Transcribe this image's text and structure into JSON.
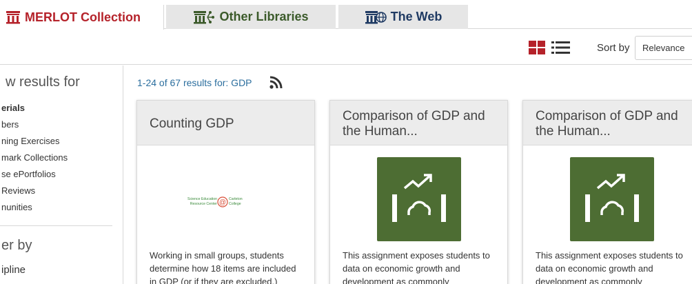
{
  "tabs": {
    "merlot": "MERLOT Collection",
    "other": "Other Libraries",
    "web": "The Web"
  },
  "toolbar": {
    "sort_label": "Sort by",
    "sort_value": "Relevance"
  },
  "sidebar": {
    "heading": "w results for",
    "items": [
      "erials",
      "bers",
      "ning Exercises",
      "mark Collections",
      "se ePortfolios",
      "Reviews",
      "nunities"
    ],
    "filter_heading": "er by",
    "filter_first": "ipline"
  },
  "results": {
    "count_text": "1-24 of 67 results for: GDP"
  },
  "cards": [
    {
      "title": "Counting GDP",
      "logo_text_left_1": "Science Education",
      "logo_text_left_2": "Resource Center",
      "logo_text_right_1": "Carleton",
      "logo_text_right_2": "College",
      "desc": "Working in small groups, students determine how 18 items are included in GDP (or if they are excluded.)"
    },
    {
      "title": "Comparison of GDP and the Human...",
      "desc": "This assignment exposes students to data on economic growth and development as commonly"
    },
    {
      "title": "Comparison of GDP and the Human...",
      "desc": "This assignment exposes students to data on economic growth and development as commonly"
    }
  ],
  "colors": {
    "merlot_red": "#b5222a",
    "other_green": "#3b5a2a",
    "web_navy": "#1f3a63",
    "exercise_icon_green": "#4d6d33",
    "link_blue": "#2b6e9e"
  },
  "icons": {
    "merlot": "library-building-icon",
    "other": "library-network-icon",
    "web": "library-globe-icon",
    "grid": "grid-view-icon",
    "list": "list-view-icon",
    "rss": "rss-icon",
    "exercise": "exercise-chart-icon"
  }
}
